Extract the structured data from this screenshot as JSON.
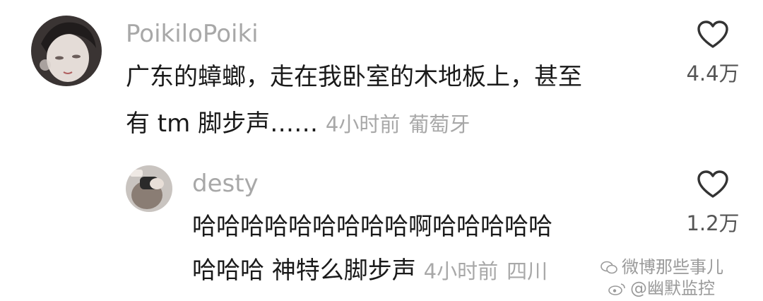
{
  "comments": [
    {
      "username": "PoikiloPoiki",
      "line1": "广东的蟑螂，走在我卧室的木地板上，甚至",
      "line2": "有 tm 脚步声……",
      "time": "4小时前",
      "location": "葡萄牙",
      "likes": "4.4万"
    },
    {
      "username": "desty",
      "line1": "哈哈哈哈哈哈哈哈哈啊哈哈哈哈哈",
      "line2": "哈哈哈 神特么脚步声",
      "time": "4小时前",
      "location": "四川",
      "likes": "1.2万"
    }
  ],
  "watermark": {
    "line1": "微博那些事儿",
    "line2": "@幽默监控"
  },
  "icons": {
    "like": "heart-outline-icon",
    "avatar": "user-avatar"
  },
  "colors": {
    "text": "#1a1a1a",
    "muted": "#a8a8a8",
    "background": "#ffffff"
  }
}
